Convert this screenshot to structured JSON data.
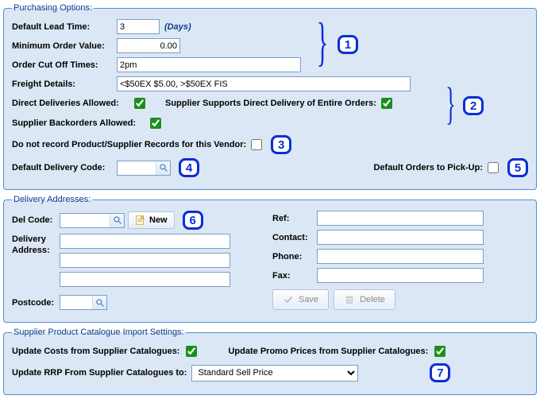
{
  "purchasing": {
    "legend": "Purchasing Options:",
    "default_lead_time_label": "Default Lead Time:",
    "default_lead_time_value": "3",
    "days_label": "(Days)",
    "min_order_value_label": "Minimum Order Value:",
    "min_order_value": "0.00",
    "order_cutoff_label": "Order Cut Off Times:",
    "order_cutoff_value": "2pm",
    "freight_details_label": "Freight Details:",
    "freight_details_value": "<$50EX $5.00, >$50EX FIS",
    "direct_deliveries_label": "Direct Deliveries Allowed:",
    "supports_direct_delivery_label": "Supplier Supports Direct Delivery of Entire Orders:",
    "backorders_label": "Supplier Backorders Allowed:",
    "no_record_label": "Do not record Product/Supplier Records for this Vendor:",
    "default_delivery_code_label": "Default Delivery Code:",
    "default_delivery_code_value": "",
    "default_pickup_label": "Default Orders to Pick-Up:"
  },
  "delivery": {
    "legend": "Delivery Addresses:",
    "del_code_label": "Del Code:",
    "del_code_value": "",
    "new_label": "New",
    "delivery_address_label_l1": "Delivery",
    "delivery_address_label_l2": "Address:",
    "postcode_label": "Postcode:",
    "ref_label": "Ref:",
    "contact_label": "Contact:",
    "phone_label": "Phone:",
    "fax_label": "Fax:",
    "save_label": "Save",
    "delete_label": "Delete"
  },
  "catalogue": {
    "legend": "Supplier Product Catalogue Import Settings:",
    "update_costs_label": "Update Costs from Supplier Catalogues:",
    "update_promo_label": "Update Promo Prices from Supplier Catalogues:",
    "update_rrp_label": "Update RRP From Supplier Catalogues to:",
    "rrp_option": "Standard Sell Price"
  },
  "callouts": {
    "c1": "1",
    "c2": "2",
    "c3": "3",
    "c4": "4",
    "c5": "5",
    "c6": "6",
    "c7": "7"
  }
}
